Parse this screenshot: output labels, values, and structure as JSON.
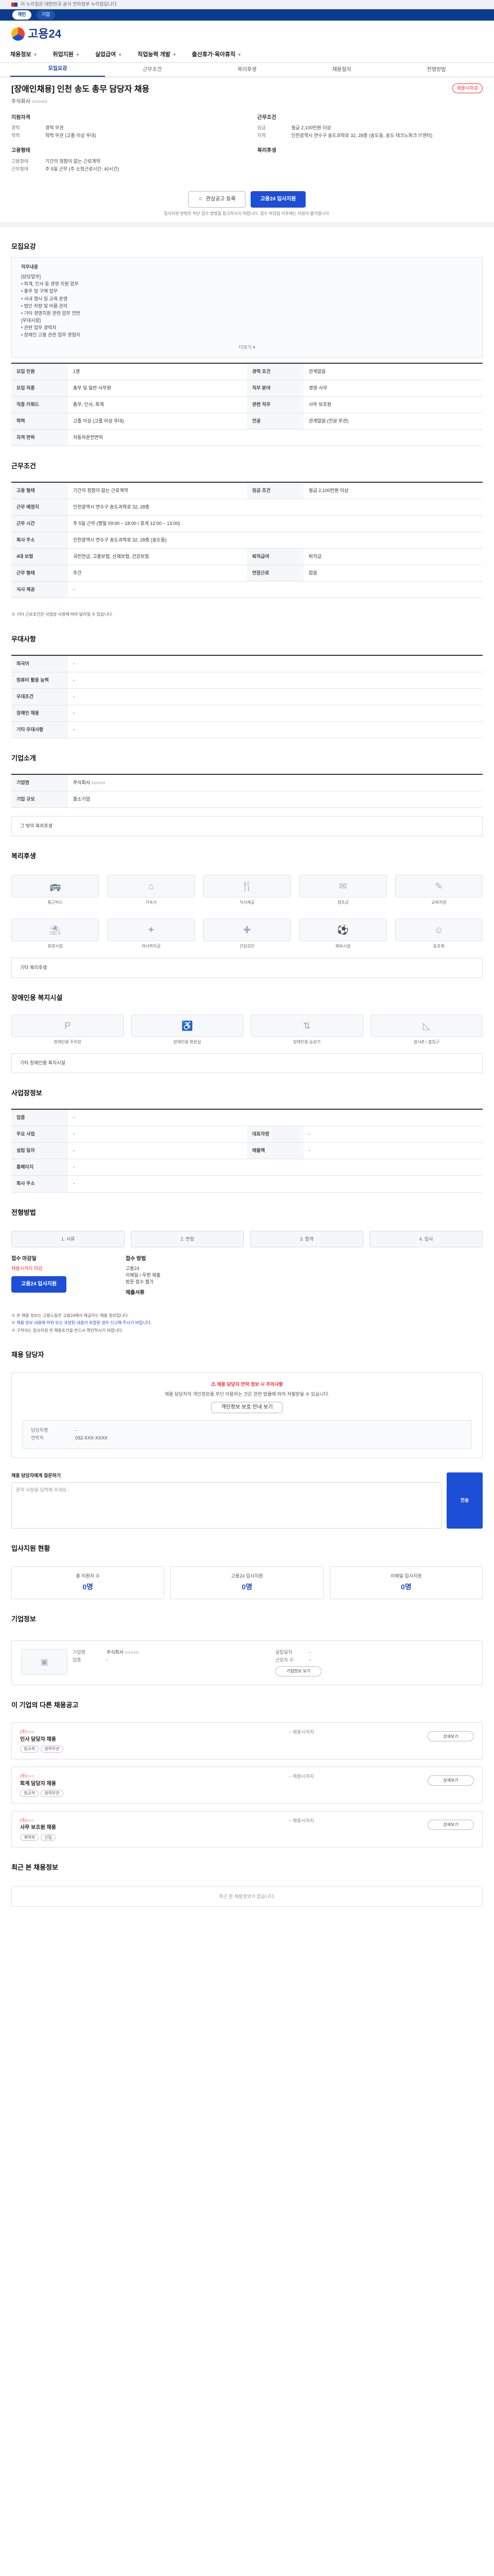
{
  "gov_banner": {
    "text": "이 누리집은 대한민국 공식 전자정부 누리집입니다."
  },
  "topbar": {
    "items": [
      "개인",
      "기업"
    ]
  },
  "logo": {
    "text": "고용24"
  },
  "gnb": [
    "채용정보",
    "취업지원",
    "실업급여",
    "직업능력 개발",
    "출산휴가·육아휴직"
  ],
  "tabs": [
    "모집요강",
    "근무조건",
    "복리후생",
    "채용절차",
    "전형방법"
  ],
  "job": {
    "title": "[장애인채용] 인천 송도 총무 담당자 채용",
    "badge": "채용시마감",
    "company": "주식회사 ○○○○○"
  },
  "summary": {
    "qualification_title": "지원자격",
    "qualification": [
      {
        "k": "경력",
        "v": "경력 무관"
      },
      {
        "k": "학력",
        "v": "학력 무관 (고졸 이상 우대)"
      }
    ],
    "conditions_title": "근무조건",
    "conditions": [
      {
        "k": "임금",
        "v": "월급 2,100만원 이상"
      },
      {
        "k": "지역",
        "v": "인천광역시 연수구 송도과학로 32, 28층 (송도동, 송도 테크노파크 IT센터)"
      }
    ],
    "employment_title": "고용형태",
    "employment": [
      {
        "k": "고용형태",
        "v": "기간의 정함이 없는 근로계약"
      },
      {
        "k": "근무형태",
        "v": "주 5일 근무 (주 소정근로시간: 40시간)"
      }
    ],
    "welfare_title": "복리후생"
  },
  "cta": {
    "scrap": "관심공고 등록",
    "apply": "고용24 입사지원",
    "note": "입사지원 방법은 하단 접수 방법을 참고하시기 바랍니다. 접수 마감일 이후에는 지원이 불가합니다."
  },
  "recruit": {
    "section_title": "모집요강",
    "duty_title": "직무내용",
    "duties": [
      "[담당업무]",
      "• 회계, 인사 등 경영 지원 업무",
      "• 총무 및 구매 업무",
      "• 사내 행사 및 교육 운영",
      "• 법인 차량 및 비품 관리",
      "• 기타 경영지원 관련 업무 전반",
      "[우대사항]",
      "• 관련 업무 경력자",
      "• 장애인 고용 관련 업무 경험자"
    ],
    "more": "더보기",
    "rows": [
      {
        "th": "모집 인원",
        "td": "1명",
        "th2": "경력 조건",
        "td2": "관계없음"
      },
      {
        "th": "모집 직종",
        "td": "총무 및 일반 사무원",
        "th2": "직무 분야",
        "td2": "경영·사무"
      },
      {
        "th": "직종 키워드",
        "td": "총무, 인사, 회계",
        "th2": "관련 직무",
        "td2": "사무 보조원"
      },
      {
        "th": "학력",
        "td": "고졸 이상 (고졸 이상 우대)",
        "th2": "전공",
        "td2": "관계없음 (전공 무관)"
      },
      {
        "th": "자격 면허",
        "td": "자동차운전면허",
        "th2": "",
        "td2": ""
      }
    ]
  },
  "work": {
    "section_title": "근무조건",
    "rows": [
      {
        "th": "고용 형태",
        "td": "기간의 정함이 없는 근로계약",
        "th2": "임금 조건",
        "td2": "월급 2,100만원 이상"
      },
      {
        "th": "근무 예정지",
        "td": "인천광역시 연수구 송도과학로 32, 28층",
        "th2": "",
        "td2": ""
      },
      {
        "th": "근무 시간",
        "td": "주 5일 근무 (평일 09:00 ~ 18:00 / 휴게 12:00 ~ 13:00)",
        "th2": "",
        "td2": ""
      },
      {
        "th": "회사 주소",
        "td": "인천광역시 연수구 송도과학로 32, 28층 (송도동)",
        "th2": "",
        "td2": ""
      },
      {
        "th": "4대 보험",
        "td": "국민연금, 고용보험, 산재보험, 건강보험",
        "th2": "퇴직급여",
        "td2": "퇴직금"
      },
      {
        "th": "근무 형태",
        "td": "주간",
        "th2": "연장근로",
        "td2": "없음"
      },
      {
        "th": "식사 제공",
        "td": "-",
        "th2": "",
        "td2": ""
      }
    ],
    "note": "※ 기타 근로조건은 사업장 사정에 따라 달라질 수 있습니다."
  },
  "extra": {
    "section_title": "우대사항",
    "rows": [
      {
        "th": "외국어",
        "td": "-"
      },
      {
        "th": "컴퓨터 활용 능력",
        "td": "-"
      },
      {
        "th": "우대조건",
        "td": "-"
      },
      {
        "th": "장애인 채용",
        "td": "-"
      },
      {
        "th": "기타 우대사항",
        "td": "-"
      }
    ]
  },
  "pr": {
    "section_title": "기업소개",
    "rows": [
      {
        "th": "기업명",
        "td": "주식회사 ○○○○○"
      },
      {
        "th": "기업 규모",
        "td": "중소기업"
      }
    ],
    "extra": "그 밖의 복리후생"
  },
  "welfare": {
    "section_title": "복리후생",
    "items": [
      "통근버스",
      "기숙사",
      "식사제공",
      "경조금",
      "교육지원",
      "휴양시설",
      "자녀학자금",
      "건강검진",
      "체육시설",
      "동호회"
    ],
    "note_title": "기타 복리후생"
  },
  "facility": {
    "section_title": "장애인용 복지시설",
    "items": [
      "장애인용 주차장",
      "장애인용 화장실",
      "장애인용 승강기",
      "경사로 / 출입구"
    ],
    "note_title": "기타 장애인용 복지시설"
  },
  "company": {
    "section_title": "사업장정보",
    "rows": [
      {
        "th": "업종",
        "td": "-",
        "th2": "",
        "td2": ""
      },
      {
        "th": "주요 사업",
        "td": "-",
        "th2": "대표자명",
        "td2": "-"
      },
      {
        "th": "설립 일자",
        "td": "-",
        "th2": "매출액",
        "td2": "-"
      },
      {
        "th": "홈페이지",
        "td": "-",
        "th2": "",
        "td2": ""
      },
      {
        "th": "회사 주소",
        "td": "-",
        "th2": "",
        "td2": ""
      }
    ]
  },
  "process": {
    "section_title": "전형방법",
    "steps": [
      "1. 서류",
      "2. 면접",
      "3. 합격",
      "4. 입사"
    ]
  },
  "apply": {
    "period_title": "접수 마감일",
    "period": "채용시까지 마감",
    "method_title": "접수 방법",
    "methods": [
      "고용24",
      "이메일 / 우편 제출",
      "방문 접수 불가"
    ],
    "docs_title": "제출서류",
    "apply_button": "고용24 입사지원",
    "notes": [
      "※ 본 채용 정보는 고용노동부 고용24에서 제공하는 채용 정보입니다.",
      "※ 채용 정보 내용에 허위 또는 과장된 내용이 포함된 경우 신고해 주시기 바랍니다.",
      "※ 구직자는 입사지원 전 채용조건을 반드시 확인하시기 바랍니다."
    ]
  },
  "contact": {
    "section_title": "채용 담당자",
    "warn": "채용 담당자 연락 정보 시 주의사항",
    "desc": "채용 담당자의 개인정보를 무단 이용하는 것은 관련 법률에 따라 처벌받을 수 있습니다.",
    "button": "개인정보 보호 안내 보기",
    "name_label": "담당자명",
    "phone_label": "연락처",
    "phone": "032-XXX-XXXX"
  },
  "question": {
    "label": "채용 담당자에게 질문하기",
    "placeholder": "문의 사항을 입력해 주세요.",
    "send": "전송"
  },
  "stats": {
    "section_title": "입사지원 현황",
    "items": [
      {
        "label": "총 지원자 수",
        "num": "0명"
      },
      {
        "label": "고용24 입사지원",
        "num": "0명"
      },
      {
        "label": "이메일 입사지원",
        "num": "0명"
      }
    ]
  },
  "info": {
    "section_title": "기업정보",
    "rows": [
      {
        "k": "기업명",
        "v": "주식회사 ○○○○○"
      },
      {
        "k": "업종",
        "v": "-"
      },
      {
        "k": "설립일자",
        "v": "-"
      },
      {
        "k": "근로자 수",
        "v": "-"
      }
    ],
    "detail_button": "기업정보 보기"
  },
  "related": {
    "section_title": "이 기업의 다른 채용공고",
    "items": [
      {
        "org": "(주)○○○",
        "title": "인사 담당자 채용",
        "tags": [
          "정규직",
          "경력무관"
        ],
        "date": "~ 채용시까지",
        "btn": "상세보기"
      },
      {
        "org": "(주)○○○",
        "title": "회계 담당자 채용",
        "tags": [
          "정규직",
          "경력무관"
        ],
        "date": "~ 채용시까지",
        "btn": "상세보기"
      },
      {
        "org": "(주)○○○",
        "title": "사무 보조원 채용",
        "tags": [
          "계약직",
          "신입"
        ],
        "date": "~ 채용시까지",
        "btn": "상세보기"
      }
    ],
    "empty_title": "최근 본 채용정보",
    "empty": "최근 본 채용정보가 없습니다."
  }
}
